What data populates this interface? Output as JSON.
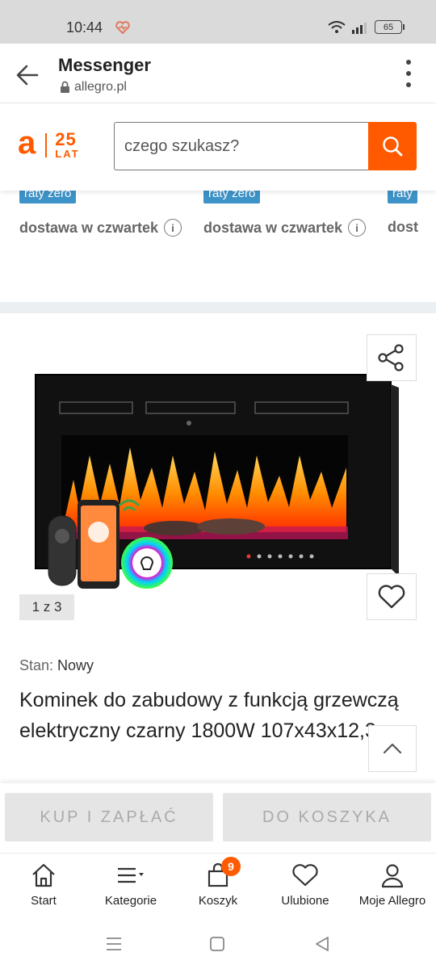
{
  "status_bar": {
    "time": "10:44",
    "battery": "65"
  },
  "browser": {
    "title": "Messenger",
    "url": "allegro.pl"
  },
  "allegro": {
    "logo_letter": "a",
    "logo_number": "25",
    "logo_word": "LAT",
    "search_placeholder": "czego szukasz?"
  },
  "listings": [
    {
      "badge": "raty zero",
      "delivery": "dostawa w czwartek"
    },
    {
      "badge": "raty zero",
      "delivery": "dostawa w czwartek"
    },
    {
      "badge": "raty",
      "delivery": "dost"
    }
  ],
  "product": {
    "image_counter": "1 z 3",
    "condition_label": "Stan:",
    "condition_value": "Nowy",
    "title": "Kominek do zabudowy z funkcją grzewczą elektryczny czarny 1800W 107x43x12,3"
  },
  "actions": {
    "buy": "KUP I ZAPŁAĆ",
    "cart": "DO KOSZYKA"
  },
  "bottom_nav": {
    "items": [
      {
        "label": "Start",
        "icon": "home-icon"
      },
      {
        "label": "Kategorie",
        "icon": "menu-list-icon"
      },
      {
        "label": "Koszyk",
        "icon": "cart-bag-icon",
        "badge": "9"
      },
      {
        "label": "Ulubione",
        "icon": "heart-icon"
      },
      {
        "label": "Moje Allegro",
        "icon": "user-icon"
      }
    ]
  },
  "colors": {
    "brand": "#ff5a00",
    "badge_blue": "#3d93c7",
    "disabled_button": "#e5e5e5"
  }
}
